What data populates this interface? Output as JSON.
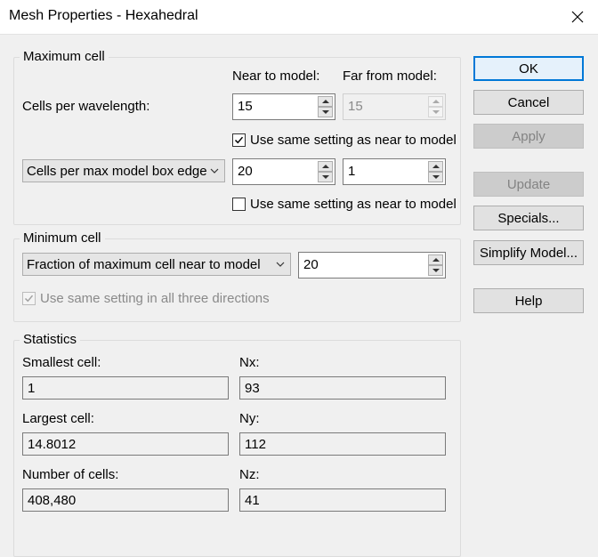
{
  "window": {
    "title": "Mesh Properties - Hexahedral"
  },
  "max_cell": {
    "title": "Maximum cell",
    "near_header": "Near to model:",
    "far_header": "Far from model:",
    "cpw_label": "Cells per wavelength:",
    "cpw_near": "15",
    "cpw_far": "15",
    "same1_label": "Use same setting as near to model",
    "same1_checked": true,
    "edge_combo": "Cells per max model box edge",
    "edge_near": "20",
    "edge_far": "1",
    "same2_label": "Use same setting as near to model",
    "same2_checked": false
  },
  "min_cell": {
    "title": "Minimum cell",
    "combo": "Fraction of maximum cell near to model",
    "value": "20",
    "same_dirs_label": "Use same setting in all three directions",
    "same_dirs_checked": true
  },
  "statistics": {
    "title": "Statistics",
    "smallest_label": "Smallest cell:",
    "smallest_value": "1",
    "nx_label": "Nx:",
    "nx_value": "93",
    "largest_label": "Largest cell:",
    "largest_value": "14.8012",
    "ny_label": "Ny:",
    "ny_value": "112",
    "count_label": "Number of cells:",
    "count_value": "408,480",
    "nz_label": "Nz:",
    "nz_value": "41"
  },
  "buttons": {
    "ok": "OK",
    "cancel": "Cancel",
    "apply": "Apply",
    "update": "Update",
    "specials": "Specials...",
    "simplify": "Simplify Model...",
    "help": "Help"
  },
  "colors": {
    "accent": "#0078d7",
    "face": "#f0f0f0"
  }
}
